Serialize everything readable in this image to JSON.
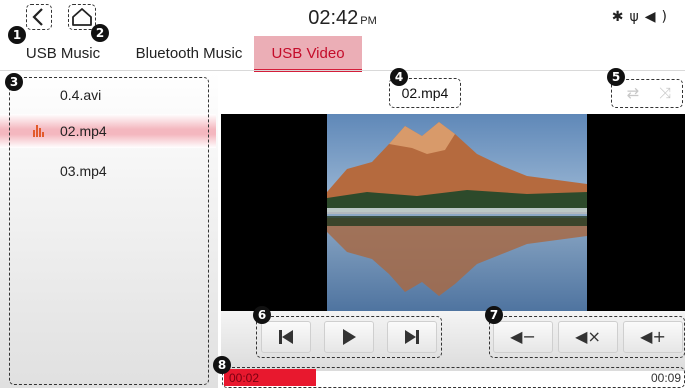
{
  "status": {
    "time": "02:42",
    "ampm": "PM",
    "icons": [
      "bluetooth-icon",
      "usb-icon",
      "volume-icon"
    ]
  },
  "nav": {
    "back_icon": "chevron-left-icon",
    "home_icon": "home-icon"
  },
  "tabs": [
    {
      "label": "USB Music",
      "active": false
    },
    {
      "label": "Bluetooth Music",
      "active": false
    },
    {
      "label": "USB Video",
      "active": true
    }
  ],
  "playlist": {
    "items": [
      {
        "label": "0.4.avi",
        "active": false
      },
      {
        "label": "02.mp4",
        "active": true
      },
      {
        "label": "03.mp4",
        "active": false
      }
    ]
  },
  "player": {
    "filename": "02.mp4",
    "modes": [
      "repeat-icon",
      "shuffle-icon"
    ],
    "controls": [
      "previous-icon",
      "play-icon",
      "next-icon"
    ],
    "volume": [
      "volume-down-icon",
      "mute-icon",
      "volume-up-icon"
    ],
    "elapsed": "00:02",
    "total": "00:09",
    "progress_fraction": 0.2
  },
  "callouts": [
    "1",
    "2",
    "3",
    "4",
    "5",
    "6",
    "7",
    "8"
  ],
  "colors": {
    "accent": "#d41e3a",
    "active_tab_bg": "#ebaeb6",
    "progress_fill": "#e8182e"
  }
}
